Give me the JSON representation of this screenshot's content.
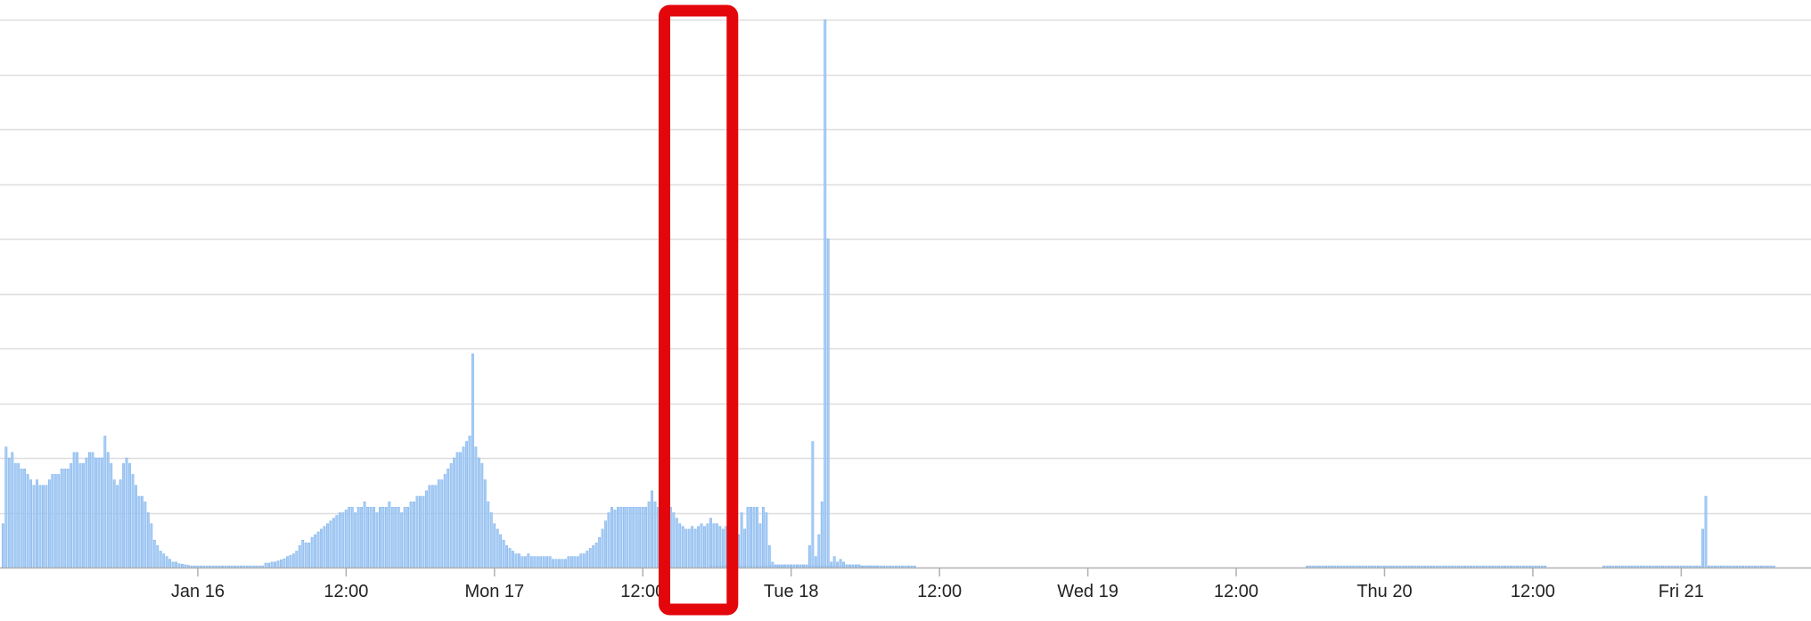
{
  "chart_data": {
    "type": "bar",
    "title": "",
    "xlabel": "",
    "ylabel": "",
    "grid": true,
    "legend": "none",
    "x_ticks": [
      "Jan 16",
      "12:00",
      "Mon 17",
      "12:00",
      "Tue 18",
      "12:00",
      "Wed 19",
      "12:00",
      "Thu 20",
      "12:00",
      "Fri 21"
    ],
    "x_range_hours": [
      -16,
      130.5
    ],
    "ylim": [
      0,
      10
    ],
    "bin_hours": 0.25,
    "series": [
      {
        "segments": [
          {
            "start": -15.75,
            "values": [
              0.8,
              2.2,
              2.0,
              2.1,
              1.9,
              1.9,
              1.8,
              1.8,
              1.7,
              1.6,
              1.5,
              1.6,
              1.5,
              1.5,
              1.5,
              1.6,
              1.7,
              1.7,
              1.7,
              1.8,
              1.8,
              1.8,
              1.9,
              2.1,
              2.1,
              1.9,
              1.9,
              2.0,
              2.1,
              2.1,
              2.0,
              2.0,
              2.0,
              2.4,
              2.1,
              1.9,
              1.6,
              1.5,
              1.6,
              1.9,
              2.0,
              1.9,
              1.7,
              1.5,
              1.3,
              1.3,
              1.2,
              1.0,
              0.8,
              0.5,
              0.4,
              0.3,
              0.25,
              0.2,
              0.15,
              0.1,
              0.1,
              0.07,
              0.06,
              0.05,
              0.04,
              0.03,
              0.03,
              0.03,
              0.03,
              0.03,
              0.03,
              0.03,
              0.03,
              0.03,
              0.03,
              0.03,
              0.03,
              0.03,
              0.03,
              0.03,
              0.03,
              0.03,
              0.03,
              0.03,
              0.03,
              0.03,
              0.03,
              0.03,
              0.03,
              0.08,
              0.08,
              0.1,
              0.1,
              0.12,
              0.14,
              0.16,
              0.2,
              0.22,
              0.25,
              0.3,
              0.4,
              0.5,
              0.45,
              0.45,
              0.55,
              0.6,
              0.65,
              0.7,
              0.75,
              0.8,
              0.85,
              0.9,
              0.95,
              1.0,
              1.0,
              1.05,
              1.1,
              1.1,
              1.0,
              1.1,
              1.1,
              1.2,
              1.1,
              1.1,
              1.1,
              1.0,
              1.1,
              1.1,
              1.1,
              1.2,
              1.1,
              1.1,
              1.1,
              1.0,
              1.1,
              1.1,
              1.2,
              1.2,
              1.3,
              1.3,
              1.3,
              1.4,
              1.5,
              1.5,
              1.5,
              1.6,
              1.6,
              1.7,
              1.8,
              1.9,
              2.0,
              2.1,
              2.1,
              2.2,
              2.3,
              2.4,
              3.9,
              2.2,
              2.0,
              1.9,
              1.6,
              1.2,
              1.0,
              0.8,
              0.7,
              0.6,
              0.5,
              0.4,
              0.35,
              0.3,
              0.25,
              0.25,
              0.2,
              0.2,
              0.25,
              0.2,
              0.2,
              0.2,
              0.2,
              0.2,
              0.2,
              0.2,
              0.15,
              0.15,
              0.15,
              0.15,
              0.15,
              0.2,
              0.2,
              0.2,
              0.2,
              0.25,
              0.25,
              0.3,
              0.35,
              0.4,
              0.45,
              0.55,
              0.7,
              0.85,
              1.0,
              1.1,
              1.05,
              1.1,
              1.1,
              1.1,
              1.1,
              1.1,
              1.1,
              1.1,
              1.1,
              1.1,
              1.1,
              1.2,
              1.4,
              1.2,
              1.1,
              1.1,
              1.05,
              1.1,
              1.1,
              1.0,
              0.9,
              0.8,
              0.75,
              0.7,
              0.7,
              0.75,
              0.7,
              0.75,
              0.8,
              0.75,
              0.8,
              0.9,
              0.8,
              0.8,
              0.75,
              0.7,
              0.75,
              0.7,
              4.5,
              0.7,
              0.6,
              1.0,
              0.7,
              1.1,
              1.1,
              1.1,
              1.1,
              0.8,
              1.1,
              1.0,
              0.4,
              0.1,
              0.05,
              0.05,
              0.05,
              0.05,
              0.05,
              0.05,
              0.05,
              0.05,
              0.05,
              0.05,
              0.05,
              0.4,
              2.3,
              0.2,
              0.6,
              1.2,
              10.0,
              6.0,
              0.1,
              0.2,
              0.1,
              0.15,
              0.1,
              0.05,
              0.05,
              0.05,
              0.05,
              0.05,
              0.03,
              0.03,
              0.03,
              0.03,
              0.03,
              0.03
            ]
          },
          {
            "start": 41.5,
            "values": [
              0.03,
              0.03,
              0.03,
              0.03,
              0.03,
              0.03,
              0.03,
              0.03,
              0.03,
              0.03,
              0.03,
              0.03,
              0.03,
              0.03,
              0.03,
              0.03,
              0.03,
              0.03,
              0.03,
              0.03,
              0.03,
              0.03,
              0.03,
              0.03,
              0.03,
              0.03,
              0.03,
              0.03,
              0.03,
              0.03,
              0.03,
              0.03,
              0.03,
              0.03,
              0.03,
              0.03,
              0.03,
              0.03,
              0.03,
              0.03,
              0.03,
              0.03,
              0.03,
              0.03,
              0.03,
              0.03,
              0.03,
              0.03,
              0.03,
              0.03,
              0.03,
              0.03,
              0.03,
              0.03,
              0.03,
              0.03,
              0.03,
              0.03,
              0.03,
              0.03,
              0.03,
              0.03,
              0.03,
              0.03,
              0.03,
              0.03,
              0.03
            ]
          },
          {
            "start": 89.75,
            "values": [
              0.03,
              0.03,
              0.03,
              0.03,
              0.03,
              0.03,
              0.03,
              0.03,
              0.03,
              0.03,
              0.03,
              0.03,
              0.03,
              0.03,
              0.03,
              0.03,
              0.03,
              0.03,
              0.03,
              0.03,
              0.03,
              0.03,
              0.03,
              0.03,
              0.03,
              0.03,
              0.03,
              0.03,
              0.03,
              0.03,
              0.03,
              0.03,
              0.03,
              0.03,
              0.03,
              0.03,
              0.03,
              0.03,
              0.03,
              0.03,
              0.03,
              0.03,
              0.03,
              0.03,
              0.03,
              0.03,
              0.03,
              0.03,
              0.03,
              0.03,
              0.03,
              0.03,
              0.03,
              0.03,
              0.03,
              0.03,
              0.03,
              0.03,
              0.03,
              0.03,
              0.03,
              0.03,
              0.03,
              0.03,
              0.03,
              0.03,
              0.03,
              0.03,
              0.03,
              0.03,
              0.03,
              0.03,
              0.03,
              0.03,
              0.03,
              0.03,
              0.03,
              0.03
            ]
          },
          {
            "start": 113.75,
            "values": [
              0.03,
              0.03,
              0.03,
              0.03,
              0.03,
              0.03,
              0.03,
              0.03,
              0.03,
              0.03,
              0.03,
              0.03,
              0.03,
              0.03,
              0.03,
              0.03,
              0.03,
              0.03,
              0.03,
              0.03,
              0.03,
              0.03,
              0.03,
              0.03,
              0.03,
              0.03,
              0.03,
              0.03,
              0.03,
              0.03,
              0.03,
              0.03,
              0.7,
              1.3,
              0.03,
              0.03,
              0.03,
              0.03,
              0.03,
              0.03,
              0.03,
              0.03,
              0.03,
              0.03,
              0.03,
              0.03,
              0.03,
              0.03,
              0.03,
              0.03,
              0.03,
              0.03,
              0.03,
              0.03,
              0.03,
              0.03
            ]
          }
        ]
      }
    ],
    "annotation": {
      "type": "highlight-rectangle",
      "color": "#e3060b",
      "x_range_hours": [
        37.75,
        43.25
      ]
    }
  },
  "colors": {
    "bar": "#a9cdf5",
    "bar_outline": "#82b5ee",
    "grid": "#dedede",
    "axis": "#b0b0b0",
    "text": "#222222",
    "highlight": "#e3060b"
  }
}
